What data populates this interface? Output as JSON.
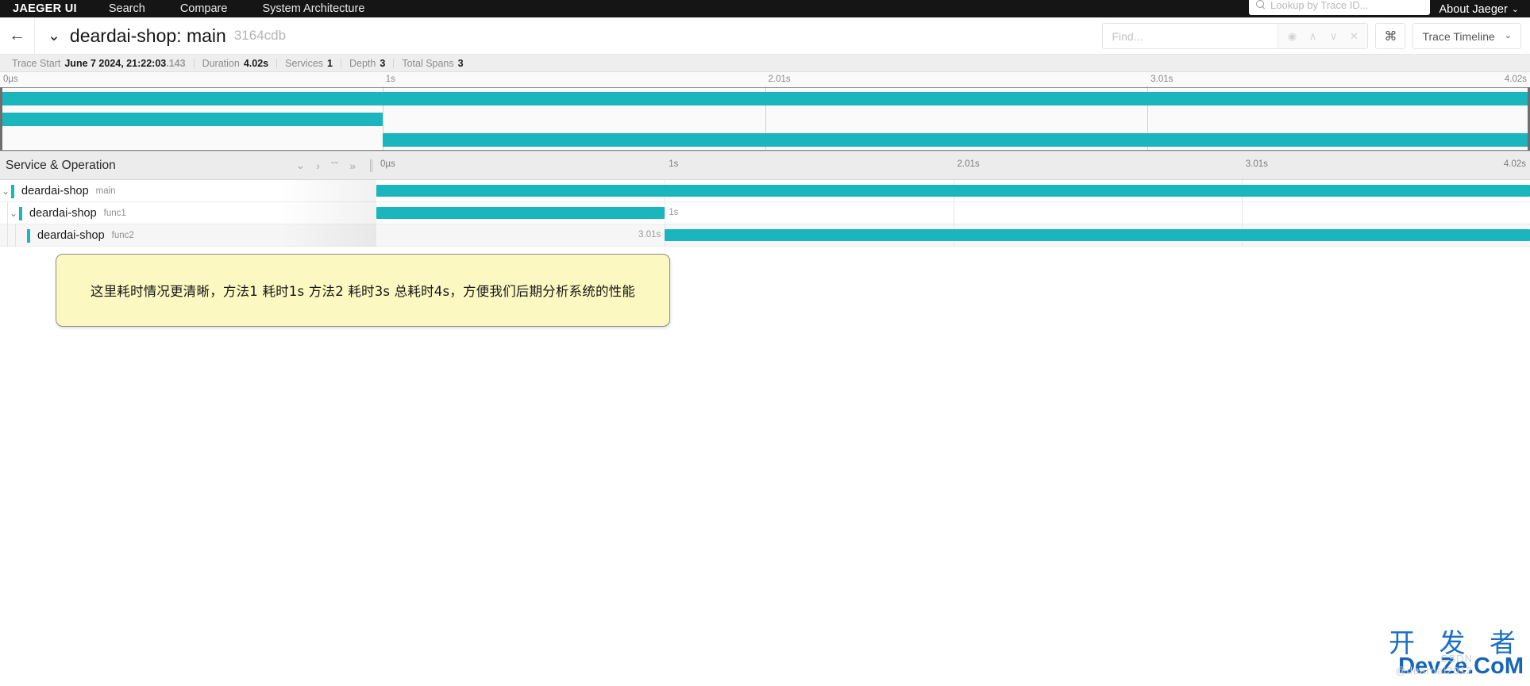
{
  "topnav": {
    "brand": "JAEGER UI",
    "items": [
      {
        "label": "Search"
      },
      {
        "label": "Compare"
      },
      {
        "label": "System Architecture"
      }
    ],
    "lookup_placeholder": "Lookup by Trace ID...",
    "about_label": "About Jaeger",
    "caret": "⌄"
  },
  "header": {
    "back_icon": "←",
    "caret": "⌄",
    "title": "deardai-shop: main",
    "trace_id": "3164cdb",
    "find_placeholder": "Find...",
    "find_value": "",
    "tools": [
      "◉",
      "∧",
      "∨",
      "✕"
    ],
    "cmd_label": "⌘",
    "view_mode": "Trace Timeline",
    "view_caret": "⌄"
  },
  "meta": [
    {
      "label": "Trace Start",
      "value": "June 7 2024, 21:22:03",
      "frac": ".143"
    },
    {
      "label": "Duration",
      "value": "4.02s",
      "frac": ""
    },
    {
      "label": "Services",
      "value": "1",
      "frac": ""
    },
    {
      "label": "Depth",
      "value": "3",
      "frac": ""
    },
    {
      "label": "Total Spans",
      "value": "3",
      "frac": ""
    }
  ],
  "minimap": {
    "ticks": [
      {
        "label": "0µs",
        "pct": 0
      },
      {
        "label": "1s",
        "pct": 25
      },
      {
        "label": "2.01s",
        "pct": 50
      },
      {
        "label": "3.01s",
        "pct": 75
      },
      {
        "label": "4.02s",
        "pct": 100
      }
    ],
    "bars": [
      {
        "name": "main",
        "left_pct": 0,
        "width_pct": 100
      },
      {
        "name": "func1",
        "left_pct": 0,
        "width_pct": 25
      },
      {
        "name": "func2",
        "left_pct": 25,
        "width_pct": 75
      }
    ]
  },
  "columns": {
    "service_operation_header": "Service & Operation",
    "icons": [
      {
        "name": "collapse-one-icon",
        "glyph": "⌄"
      },
      {
        "name": "expand-one-icon",
        "glyph": "›"
      },
      {
        "name": "collapse-all-icon",
        "glyph": "ˇˇ"
      },
      {
        "name": "expand-all-icon",
        "glyph": "»"
      }
    ],
    "ticks": [
      {
        "label": "0µs",
        "pct": 0
      },
      {
        "label": "1s",
        "pct": 25
      },
      {
        "label": "2.01s",
        "pct": 50
      },
      {
        "label": "3.01s",
        "pct": 75
      },
      {
        "label": "4.02s",
        "pct": 100
      }
    ]
  },
  "spans": [
    {
      "service": "deardai-shop",
      "operation": "main",
      "depth": 0,
      "caret": "⌄",
      "has_caret": true,
      "left_pct": 0,
      "width_pct": 100,
      "duration_label": "",
      "label_side": "none",
      "alt": false
    },
    {
      "service": "deardai-shop",
      "operation": "func1",
      "depth": 1,
      "caret": "⌄",
      "has_caret": true,
      "left_pct": 0,
      "width_pct": 25,
      "duration_label": "1s",
      "label_side": "right",
      "alt": false
    },
    {
      "service": "deardai-shop",
      "operation": "func2",
      "depth": 2,
      "caret": "",
      "has_caret": false,
      "left_pct": 25,
      "width_pct": 75,
      "duration_label": "3.01s",
      "label_side": "left",
      "alt": true
    }
  ],
  "annotation": {
    "text": "这里耗时情况更清晰，方法1 耗时1s 方法2 耗时3s  总耗时4s，方便我们后期分析系统的性能"
  },
  "watermark": {
    "cn": "开 发 者",
    "en": "DevZe.CoM",
    "sub": "CSDN @deardai2012"
  },
  "colors": {
    "span_bar": "#1ab5bd",
    "annotation_bg": "#fbf8c2",
    "nav_bg": "#151515"
  }
}
